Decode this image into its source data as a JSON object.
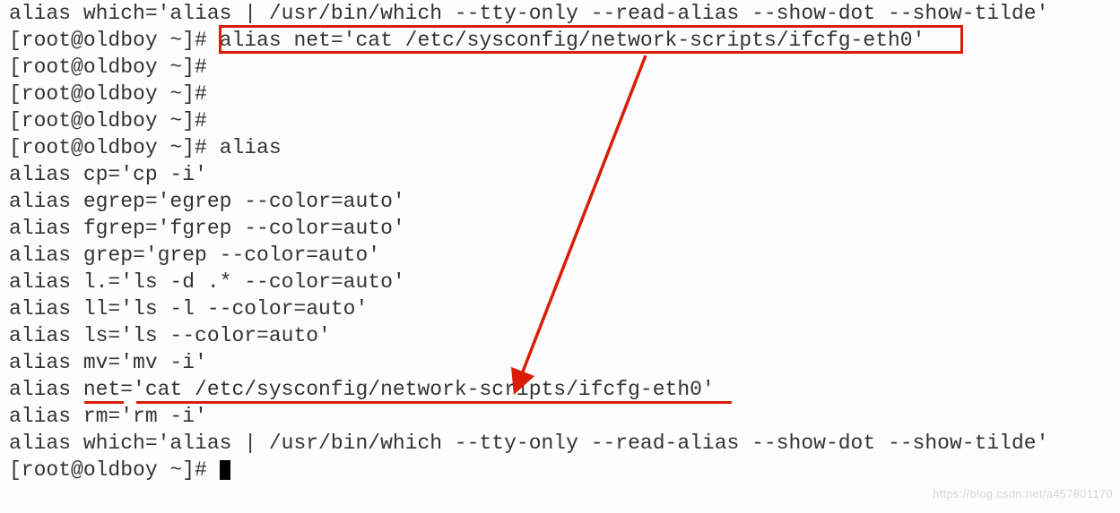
{
  "lines": {
    "l0": "alias which='alias | /usr/bin/which --tty-only --read-alias --show-dot --show-tilde'",
    "l1_prompt": "[root@oldboy ~]# ",
    "l1_cmd": "alias net='cat /etc/sysconfig/network-scripts/ifcfg-eth0'",
    "l2": "[root@oldboy ~]# ",
    "l3": "[root@oldboy ~]# ",
    "l4": "[root@oldboy ~]# ",
    "l5": "[root@oldboy ~]# alias",
    "l6": "alias cp='cp -i'",
    "l7": "alias egrep='egrep --color=auto'",
    "l8": "alias fgrep='fgrep --color=auto'",
    "l9": "alias grep='grep --color=auto'",
    "l10": "alias l.='ls -d .* --color=auto'",
    "l11": "alias ll='ls -l --color=auto'",
    "l12": "alias ls='ls --color=auto'",
    "l13": "alias mv='mv -i'",
    "l14": "alias net='cat /etc/sysconfig/network-scripts/ifcfg-eth0'",
    "l15": "alias rm='rm -i'",
    "l16": "alias which='alias | /usr/bin/which --tty-only --read-alias --show-dot --show-tilde'",
    "l17": "[root@oldboy ~]# "
  },
  "watermark": "https://blog.csdn.net/a457801170"
}
